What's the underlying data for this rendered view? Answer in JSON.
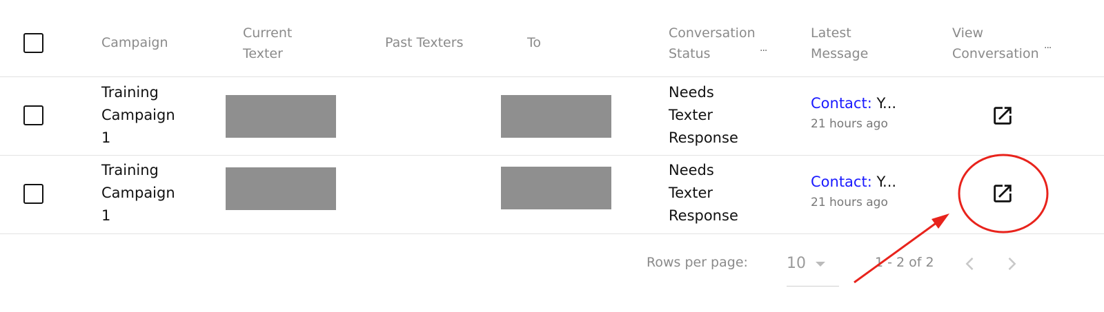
{
  "table": {
    "headers": {
      "campaign": "Campaign",
      "current_texter": [
        "Current",
        "Texter"
      ],
      "past_texters": "Past Texters",
      "to": "To",
      "conversation_status": [
        "Conversation",
        "Status"
      ],
      "latest_message": [
        "Latest",
        "Message"
      ],
      "view_conversation": [
        "View",
        "Conversation"
      ],
      "more_indicator": "..."
    },
    "rows": [
      {
        "campaign": [
          "Training",
          "Campaign",
          "1"
        ],
        "status": [
          "Needs",
          "Texter",
          "Response"
        ],
        "message_sender": "Contact:",
        "message_text": " Y...",
        "message_time": "21 hours ago"
      },
      {
        "campaign": [
          "Training",
          "Campaign",
          "1"
        ],
        "status": [
          "Needs",
          "Texter",
          "Response"
        ],
        "message_sender": "Contact:",
        "message_text": " Y...",
        "message_time": "21 hours ago"
      }
    ]
  },
  "pagination": {
    "rows_per_page_label": "Rows per page:",
    "rows_per_page_value": "10",
    "range_text": "1 - 2 of 2"
  },
  "icons": {
    "open_conversation": "open-in-new-icon",
    "prev_page": "chevron-left-icon",
    "next_page": "chevron-right-icon",
    "dropdown": "caret-down-icon"
  },
  "colors": {
    "contact_label": "#1a1aff",
    "redaction": "#8f8f8f",
    "annotation": "#e8231c"
  }
}
